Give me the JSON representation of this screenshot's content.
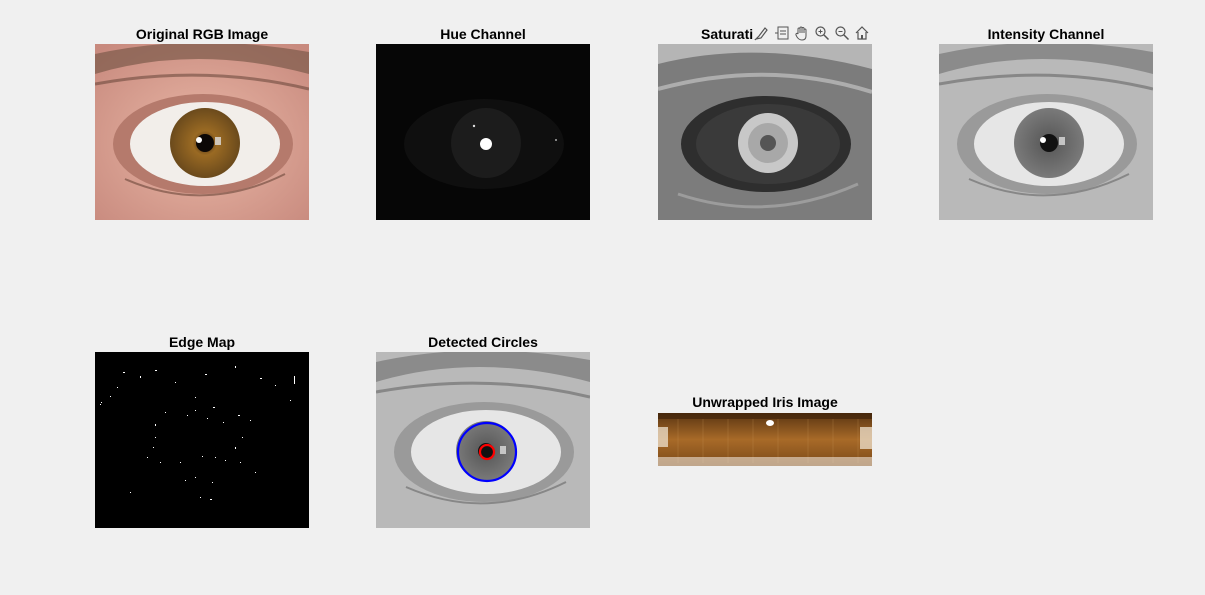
{
  "figure": {
    "panels": [
      {
        "title": "Original RGB Image"
      },
      {
        "title": "Hue Channel"
      },
      {
        "title": "Saturati"
      },
      {
        "title": "Intensity Channel"
      },
      {
        "title": "Edge Map"
      },
      {
        "title": "Detected Circles"
      },
      {
        "title": "Unwrapped Iris Image"
      }
    ]
  },
  "axes_toolbar": {
    "icons": [
      "brush-icon",
      "datatip-icon",
      "pan-hand-icon",
      "zoom-in-icon",
      "zoom-out-icon",
      "home-icon"
    ]
  },
  "colors": {
    "background": "#f0f0f0",
    "detected_iris_circle": "#0000ff",
    "detected_pupil_circle": "#ff0000"
  }
}
